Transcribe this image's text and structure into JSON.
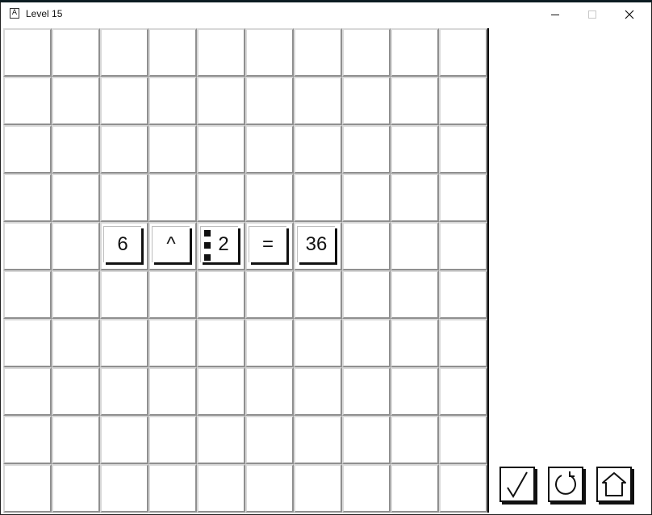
{
  "window": {
    "title": "Level 15",
    "app_icon_letter": "A",
    "controls": [
      "minimize-icon",
      "maximize-icon",
      "close-icon"
    ]
  },
  "board": {
    "rows": 10,
    "cols": 10,
    "tiles": [
      {
        "row": 4,
        "col": 2,
        "label": "6",
        "marker": false
      },
      {
        "row": 4,
        "col": 3,
        "label": "^",
        "marker": false
      },
      {
        "row": 4,
        "col": 4,
        "label": "2",
        "marker": true
      },
      {
        "row": 4,
        "col": 5,
        "label": "=",
        "marker": false
      },
      {
        "row": 4,
        "col": 6,
        "label": "36",
        "marker": false
      }
    ]
  },
  "controls": [
    {
      "name": "check-button",
      "icon": "checkmark-icon"
    },
    {
      "name": "restart-button",
      "icon": "restart-icon"
    },
    {
      "name": "home-button",
      "icon": "home-icon"
    }
  ]
}
